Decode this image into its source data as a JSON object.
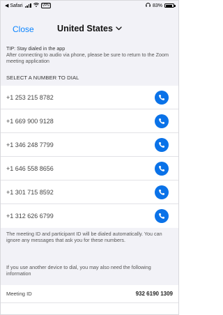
{
  "status_bar": {
    "back_app": "◀ Safari",
    "vpn": "VPN",
    "battery": "83%",
    "battery_level": 0.83
  },
  "nav": {
    "close_label": "Close",
    "title": "United States"
  },
  "tip": {
    "title": "TIP: Stay dialed in the app",
    "body": "After connecting to audio via phone, please be sure to return to the Zoom meeting application"
  },
  "section_header": "SELECT A NUMBER TO DIAL",
  "numbers": [
    "+1 253 215 8782",
    "+1 669 900 9128",
    "+1 346 248 7799",
    "+1 646 558 8656",
    "+1 301 715 8592",
    "+1 312 626 6799"
  ],
  "note": "The meeting ID and participant ID will be dialed automatically. You can ignore any messages that ask you for these numbers.",
  "note2": "If you use another device to dial, you may also need the following information",
  "meeting": {
    "id_label": "Meeting ID",
    "id_value": "932 6190 1309"
  },
  "colors": {
    "accent": "#0a84ff",
    "call_button": "#0a72e8",
    "background": "#f2f2f7"
  },
  "icons": {
    "call": "phone-handset-icon",
    "chevron": "chevron-down-icon"
  }
}
